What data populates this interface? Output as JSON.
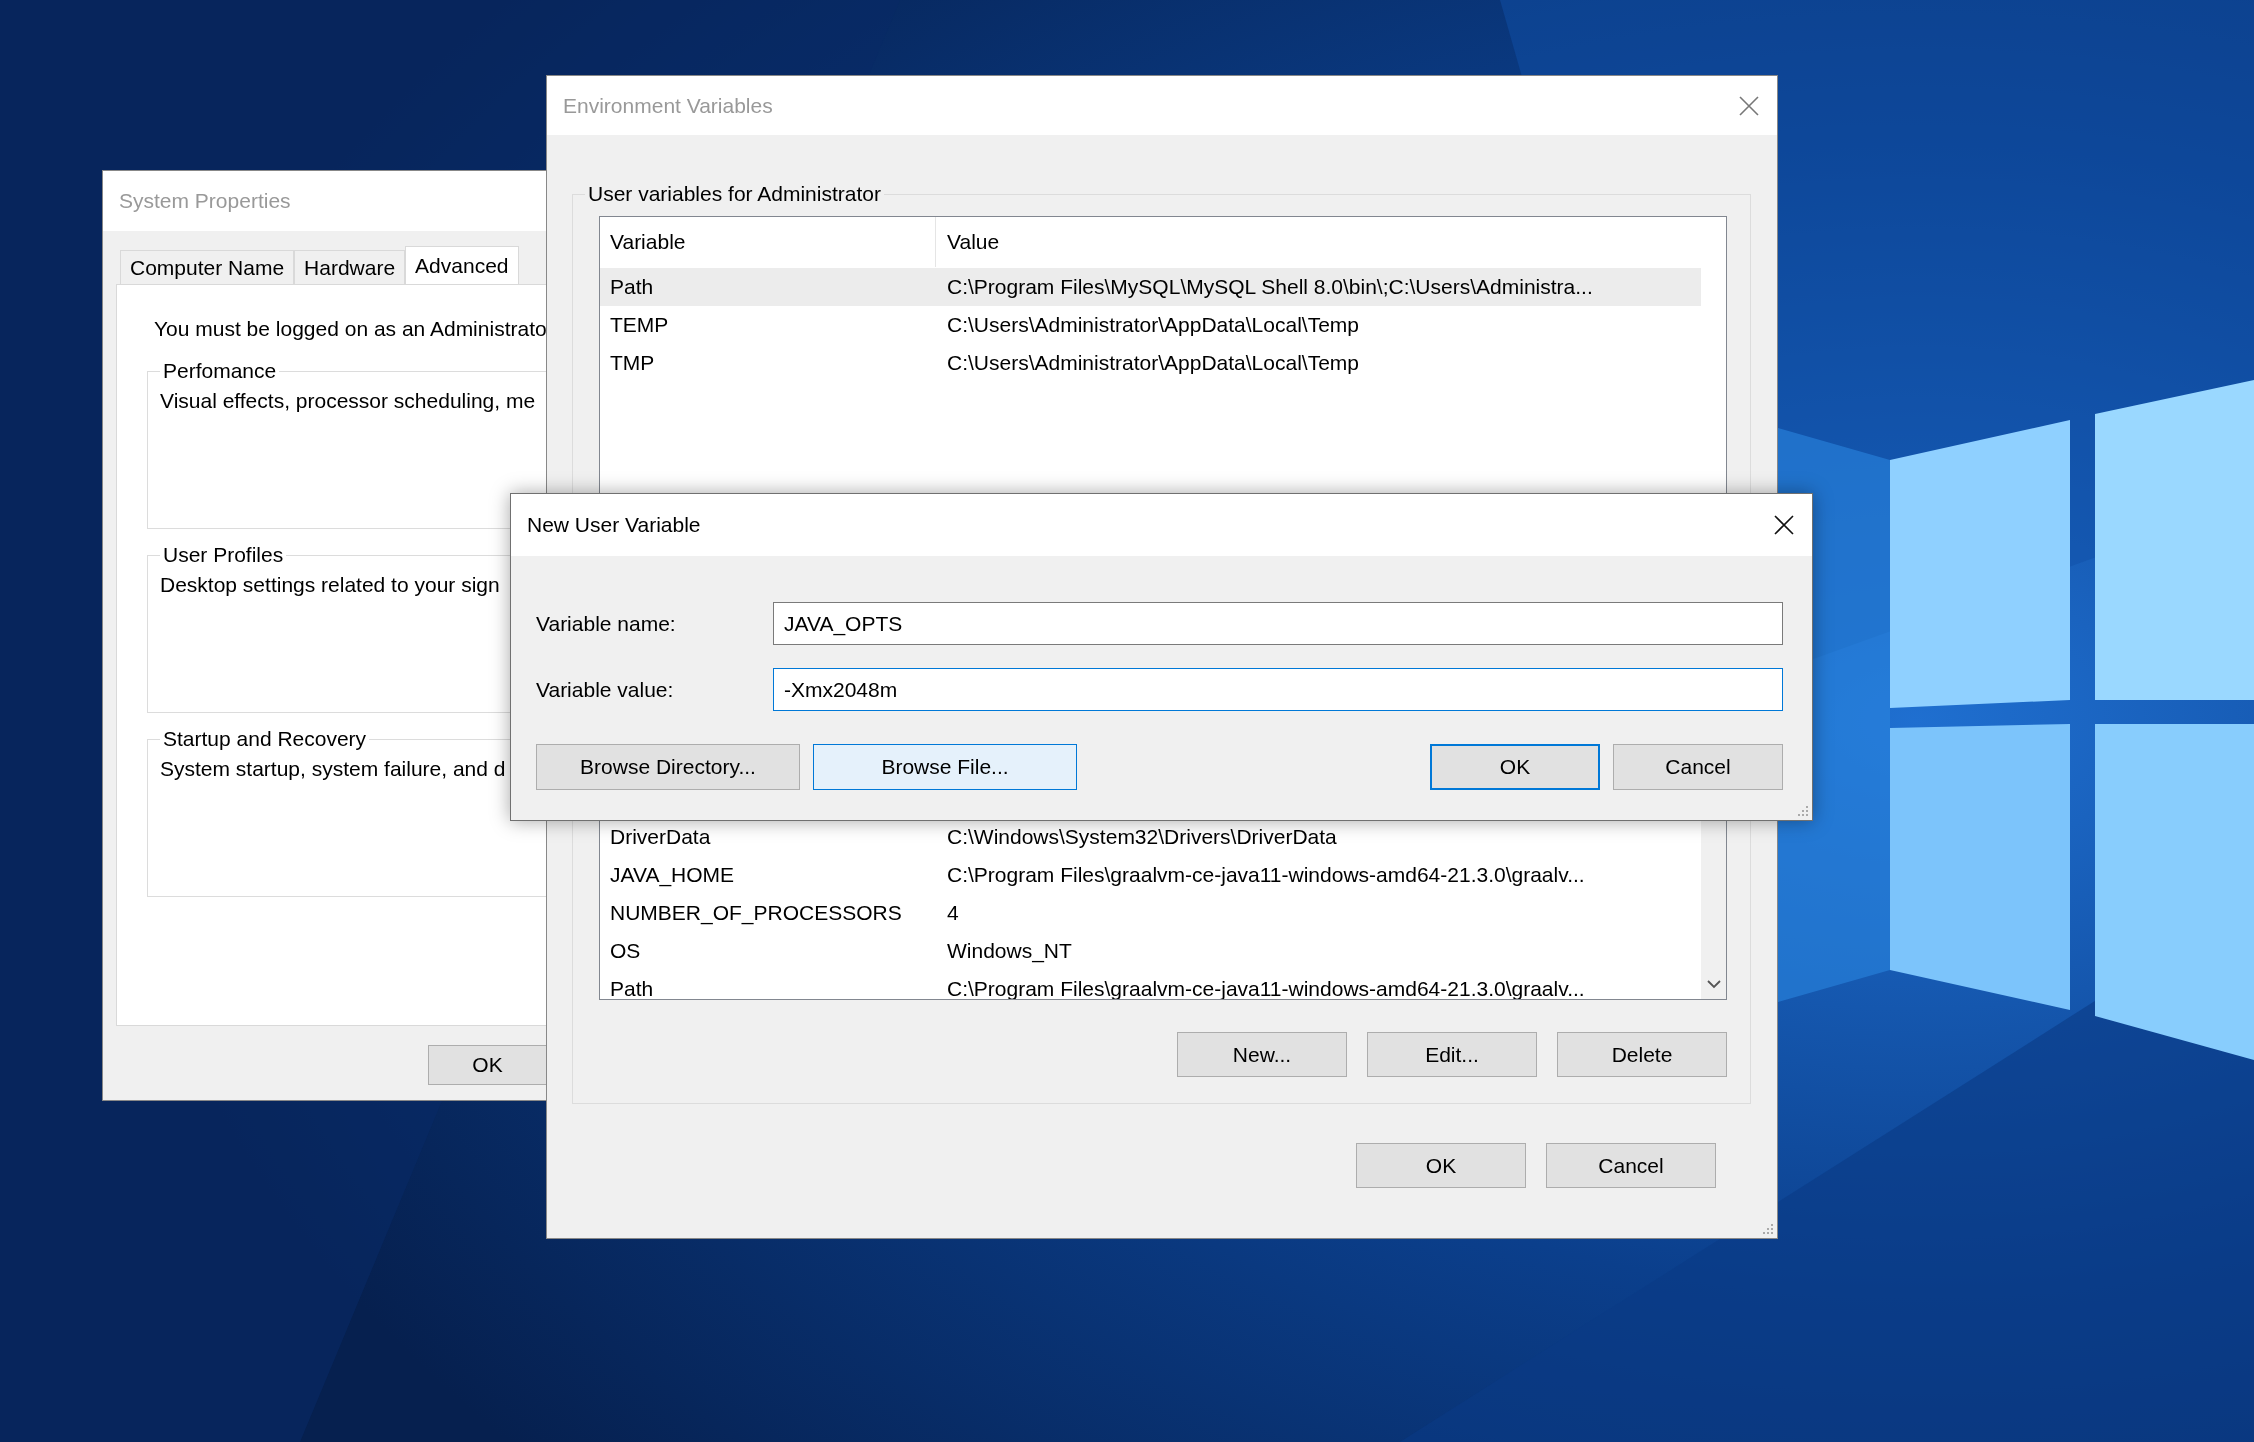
{
  "system_properties": {
    "title": "System Properties",
    "tabs": [
      {
        "label": "Computer Name",
        "selected": false
      },
      {
        "label": "Hardware",
        "selected": false
      },
      {
        "label": "Advanced",
        "selected": true
      }
    ],
    "notice": "You must be logged on as an Administrato",
    "groups": [
      {
        "title": "Perfomance",
        "text": "Visual effects, processor scheduling, me"
      },
      {
        "title": "User Profiles",
        "text": "Desktop settings related to your sign"
      },
      {
        "title": "Startup and Recovery",
        "text": "System startup, system failure, and d"
      }
    ],
    "buttons": [
      "OK"
    ]
  },
  "environment_variables": {
    "title": "Environment Variables",
    "user_variables": {
      "title": "User variables for Administrator",
      "columns": [
        "Variable",
        "Value"
      ],
      "rows": [
        {
          "variable": "Path",
          "value": "C:\\Program Files\\MySQL\\MySQL Shell 8.0\\bin\\;C:\\Users\\Administra...",
          "selected": true
        },
        {
          "variable": "TEMP",
          "value": "C:\\Users\\Administrator\\AppData\\Local\\Temp",
          "selected": false
        },
        {
          "variable": "TMP",
          "value": "C:\\Users\\Administrator\\AppData\\Local\\Temp",
          "selected": false
        }
      ]
    },
    "system_rows": [
      {
        "variable": "DriverData",
        "value": "C:\\Windows\\System32\\Drivers\\DriverData",
        "selected": false
      },
      {
        "variable": "JAVA_HOME",
        "value": "C:\\Program Files\\graalvm-ce-java11-windows-amd64-21.3.0\\graalv...",
        "selected": false
      },
      {
        "variable": "NUMBER_OF_PROCESSORS",
        "value": "4",
        "selected": false
      },
      {
        "variable": "OS",
        "value": "Windows_NT",
        "selected": false
      },
      {
        "variable": "Path",
        "value": "C:\\Program Files\\graalvm-ce-java11-windows-amd64-21.3.0\\graalv...",
        "selected": false
      }
    ],
    "list_buttons": [
      "New...",
      "Edit...",
      "Delete"
    ],
    "buttons": [
      "OK",
      "Cancel"
    ]
  },
  "new_user_variable": {
    "title": "New User Variable",
    "fields": [
      {
        "label": "Variable name:",
        "value": "JAVA_OPTS",
        "focused": false
      },
      {
        "label": "Variable value:",
        "value": "-Xmx2048m",
        "focused": true
      }
    ],
    "left_buttons": [
      {
        "label": "Browse Directory...",
        "kind": "normal"
      },
      {
        "label": "Browse File...",
        "kind": "hover"
      }
    ],
    "right_buttons": [
      {
        "label": "OK",
        "kind": "default"
      },
      {
        "label": "Cancel",
        "kind": "normal"
      }
    ]
  }
}
